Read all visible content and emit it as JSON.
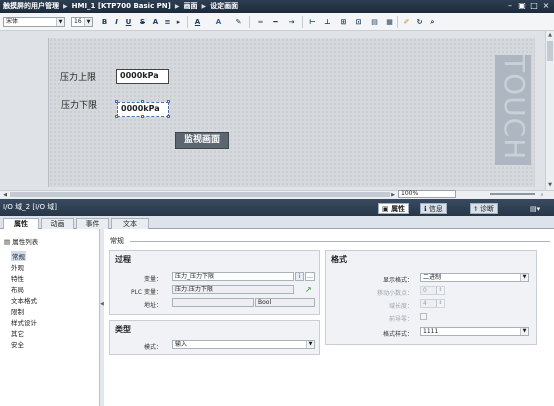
{
  "title_bar": {
    "breadcrumb": [
      "触摸屏的用户管理",
      "HMI_1 [KTP700 Basic PN]",
      "画面",
      "设定画面"
    ],
    "controls": [
      "minimize-icon",
      "restore-icon",
      "maximize-icon",
      "close-icon"
    ]
  },
  "toolbar": {
    "font_name": "宋体",
    "font_size": "16",
    "bold": "B",
    "italic": "I",
    "underline": "U",
    "strike": "S",
    "superscript": "A",
    "text_color_glyph": "A",
    "fill_glyph": "A"
  },
  "screen": {
    "upper_limit_label": "压力上限",
    "lower_limit_label": "压力下限",
    "upper_field_value": "0000kPa",
    "lower_field_value": "0000kPa",
    "monitor_button_label": "监视画面",
    "logo_text": "TOUCH"
  },
  "zoom": {
    "value": "100%"
  },
  "inspector": {
    "object_title": "I/O 域_2 [I/O 域]",
    "tabs": [
      {
        "label": "属性",
        "icon": "properties-icon"
      },
      {
        "label": "信息",
        "icon": "info-icon"
      },
      {
        "label": "诊断",
        "icon": "diagnostics-icon"
      }
    ],
    "subtabs": [
      "属性",
      "动画",
      "事件",
      "文本"
    ],
    "property_list_label": "属性列表",
    "tree": [
      "常规",
      "外观",
      "特性",
      "布局",
      "文本格式",
      "限制",
      "样式设计",
      "其它",
      "安全"
    ],
    "section_title": "常规"
  },
  "process": {
    "title": "过程",
    "variable_label": "变量：",
    "variable_value": "压力_压力下限",
    "plc_variable_label": "PLC 变量：",
    "plc_variable_value": "压力.压力下限",
    "address_label": "地址：",
    "address_type": "Bool"
  },
  "type_group": {
    "title": "类型",
    "mode_label": "模式：",
    "mode_value": "输入"
  },
  "format": {
    "title": "格式",
    "display_format_label": "显示格式：",
    "display_format_value": "二进制",
    "decimal_places_label": "移动小数点：",
    "decimal_places_value": "0",
    "field_length_label": "域长度：",
    "field_length_value": "4",
    "leading_zeros_label": "前导零：",
    "format_pattern_label": "格式样式：",
    "format_pattern_value": "1111"
  }
}
